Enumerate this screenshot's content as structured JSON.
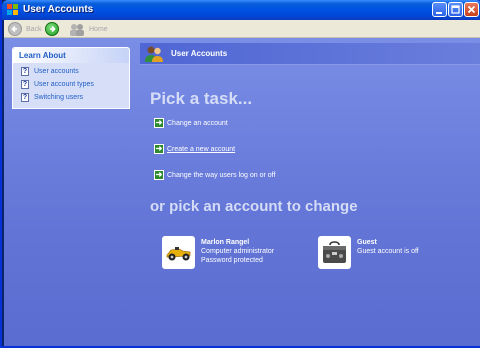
{
  "window": {
    "title": "User Accounts"
  },
  "toolbar": {
    "back_label": "Back",
    "home_label": "Home"
  },
  "learn_about": {
    "heading": "Learn About",
    "items": [
      {
        "label": "User accounts"
      },
      {
        "label": "User account types"
      },
      {
        "label": "Switching users"
      }
    ]
  },
  "header": {
    "title": "User Accounts"
  },
  "main": {
    "pick_task_heading": "Pick a task...",
    "tasks": [
      {
        "label": "Change an account"
      },
      {
        "label": "Create a new account"
      },
      {
        "label": "Change the way users log on or off"
      }
    ],
    "pick_account_heading": "or pick an account to change",
    "accounts": [
      {
        "name": "Marlon Rangel",
        "type": "Computer administrator",
        "status": "Password protected"
      },
      {
        "name": "Guest",
        "type": "Guest account is off",
        "status": ""
      }
    ]
  },
  "colors": {
    "background": "#6375d6",
    "titlebar": "#0054e3",
    "panel": "#d6dff7",
    "link": "#215dc6"
  }
}
